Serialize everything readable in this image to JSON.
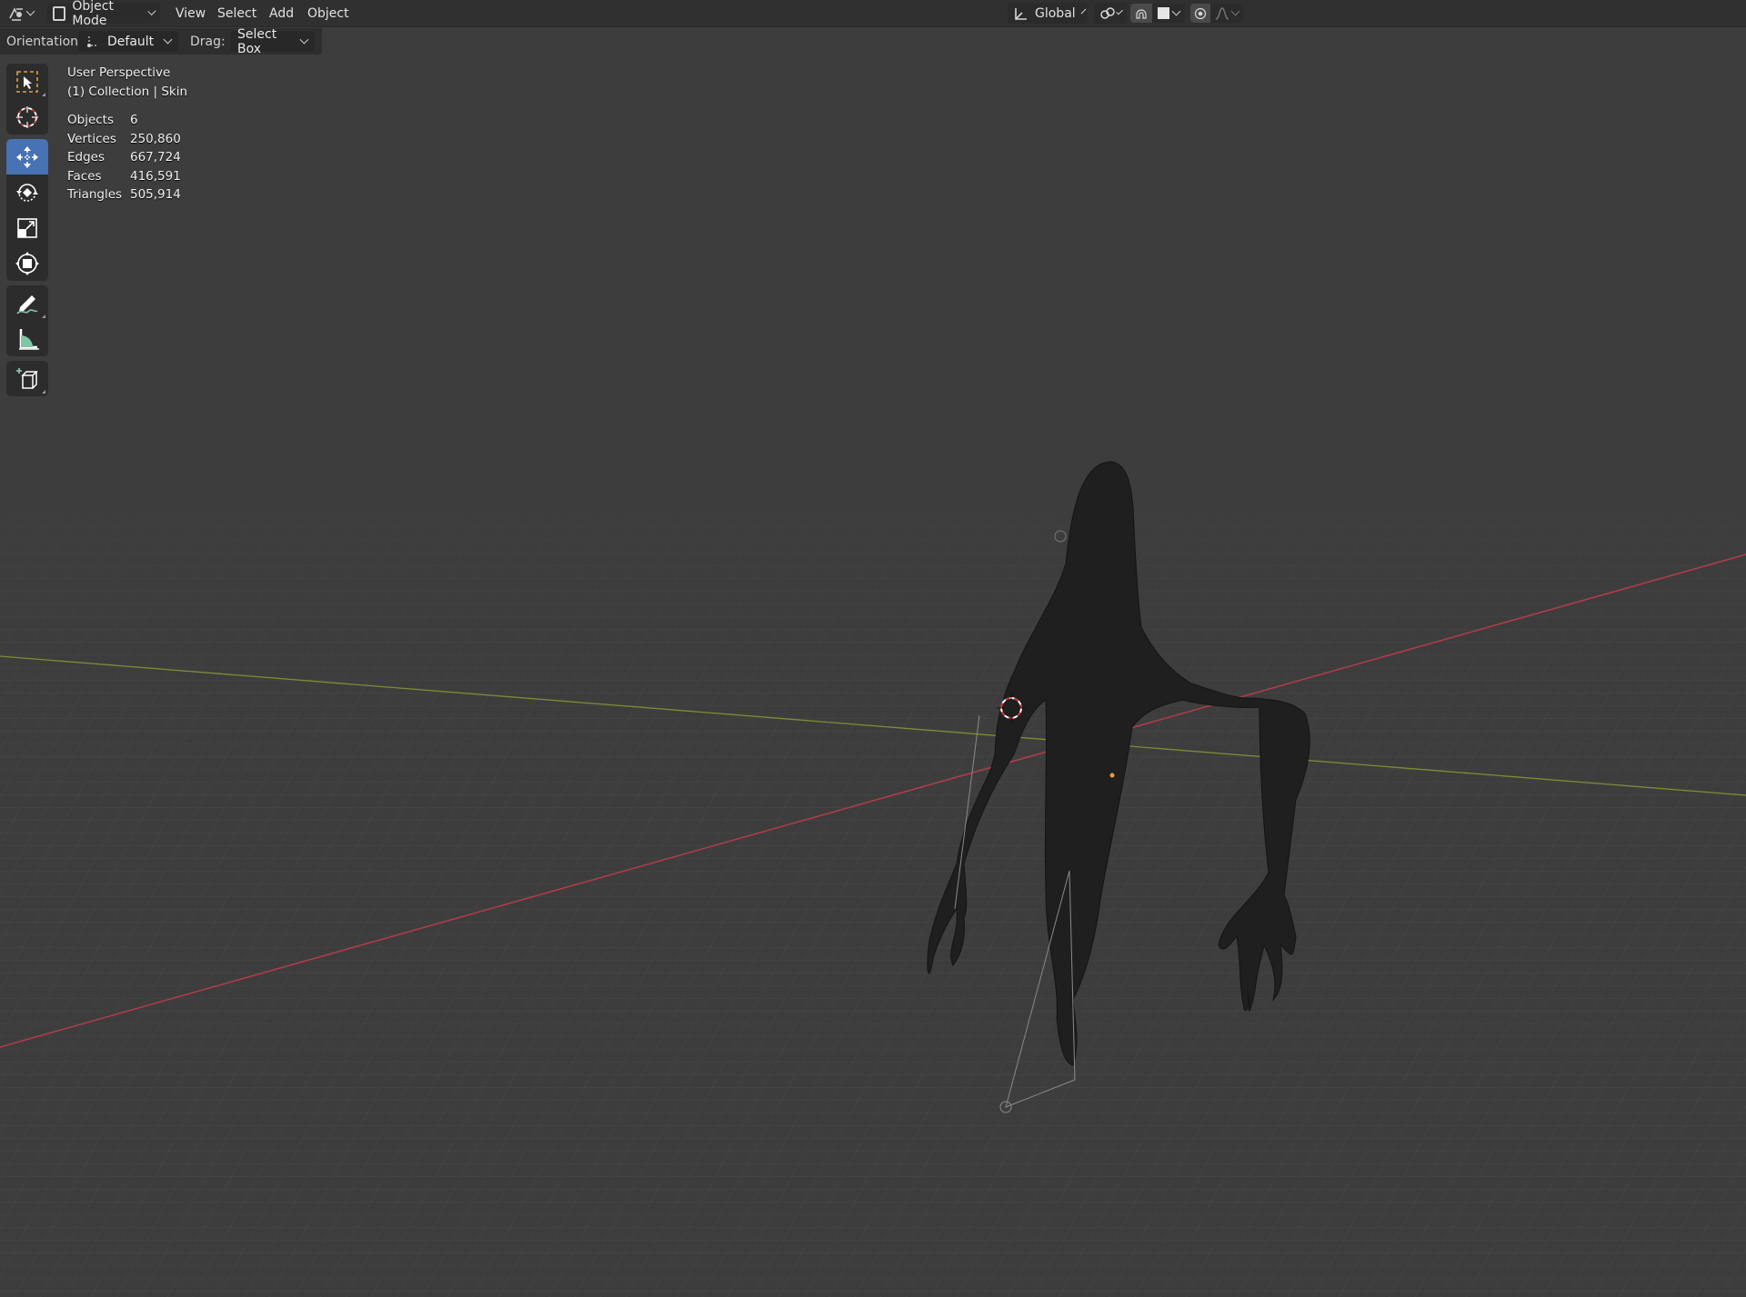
{
  "header": {
    "mode": "Object Mode",
    "menus": [
      "View",
      "Select",
      "Add",
      "Object"
    ],
    "transform_orientation": "Global"
  },
  "options": {
    "orientation_label": "Orientation:",
    "orientation_value": "Default",
    "drag_label": "Drag:",
    "drag_value": "Select Box"
  },
  "overlay": {
    "view_name": "User Perspective",
    "collection": "(1) Collection | Skin",
    "stats": [
      {
        "label": "Objects",
        "value": "6"
      },
      {
        "label": "Vertices",
        "value": "250,860"
      },
      {
        "label": "Edges",
        "value": "667,724"
      },
      {
        "label": "Faces",
        "value": "416,591"
      },
      {
        "label": "Triangles",
        "value": "505,914"
      }
    ]
  },
  "toolbar": {
    "tools": [
      "select-box-icon",
      "cursor-icon",
      "move-icon",
      "rotate-icon",
      "scale-icon",
      "transform-icon",
      "annotate-icon",
      "measure-icon",
      "add-cube-icon"
    ],
    "active": "move-icon"
  },
  "colors": {
    "background": "#3d3d3d",
    "header": "#303030",
    "active_tool": "#4772b3",
    "x_axis": "#b53c4a",
    "y_axis": "#7a8f34"
  }
}
